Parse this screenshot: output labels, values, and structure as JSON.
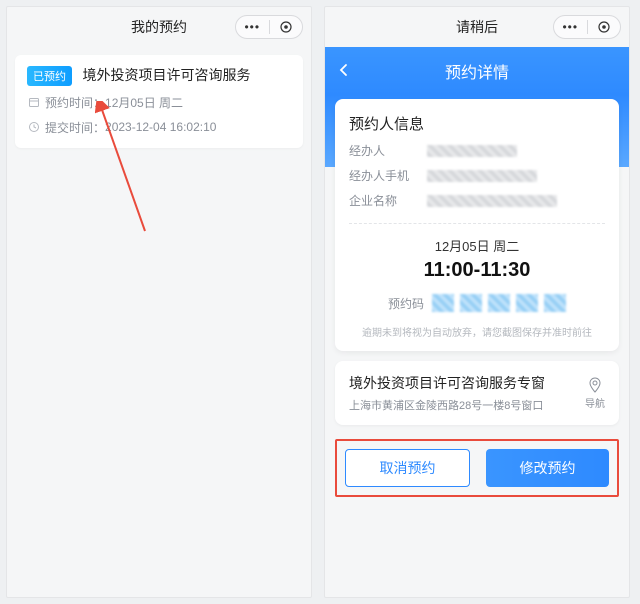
{
  "left": {
    "titlebar": "我的预约",
    "card": {
      "badge": "已预约",
      "title": "境外投资项目许可咨询服务",
      "appt_label": "预约时间：",
      "appt_value": "12月05日 周二",
      "submit_label": "提交时间：",
      "submit_value": "2023-12-04 16:02:10"
    }
  },
  "right": {
    "titlebar": "请稍后",
    "hero_title": "预约详情",
    "info_heading": "预约人信息",
    "info_rows": {
      "handler": "经办人",
      "phone": "经办人手机",
      "company": "企业名称"
    },
    "slot": {
      "date": "12月05日 周二",
      "time": "11:00-11:30",
      "code_label": "预约码"
    },
    "hint": "逾期未到将视为自动放弃，请您截图保存并准时前往",
    "window": {
      "title": "境外投资项目许可咨询服务专窗",
      "address": "上海市黄浦区金陵西路28号一楼8号窗口",
      "nav_label": "导航"
    },
    "buttons": {
      "cancel": "取消预约",
      "modify": "修改预约"
    }
  }
}
